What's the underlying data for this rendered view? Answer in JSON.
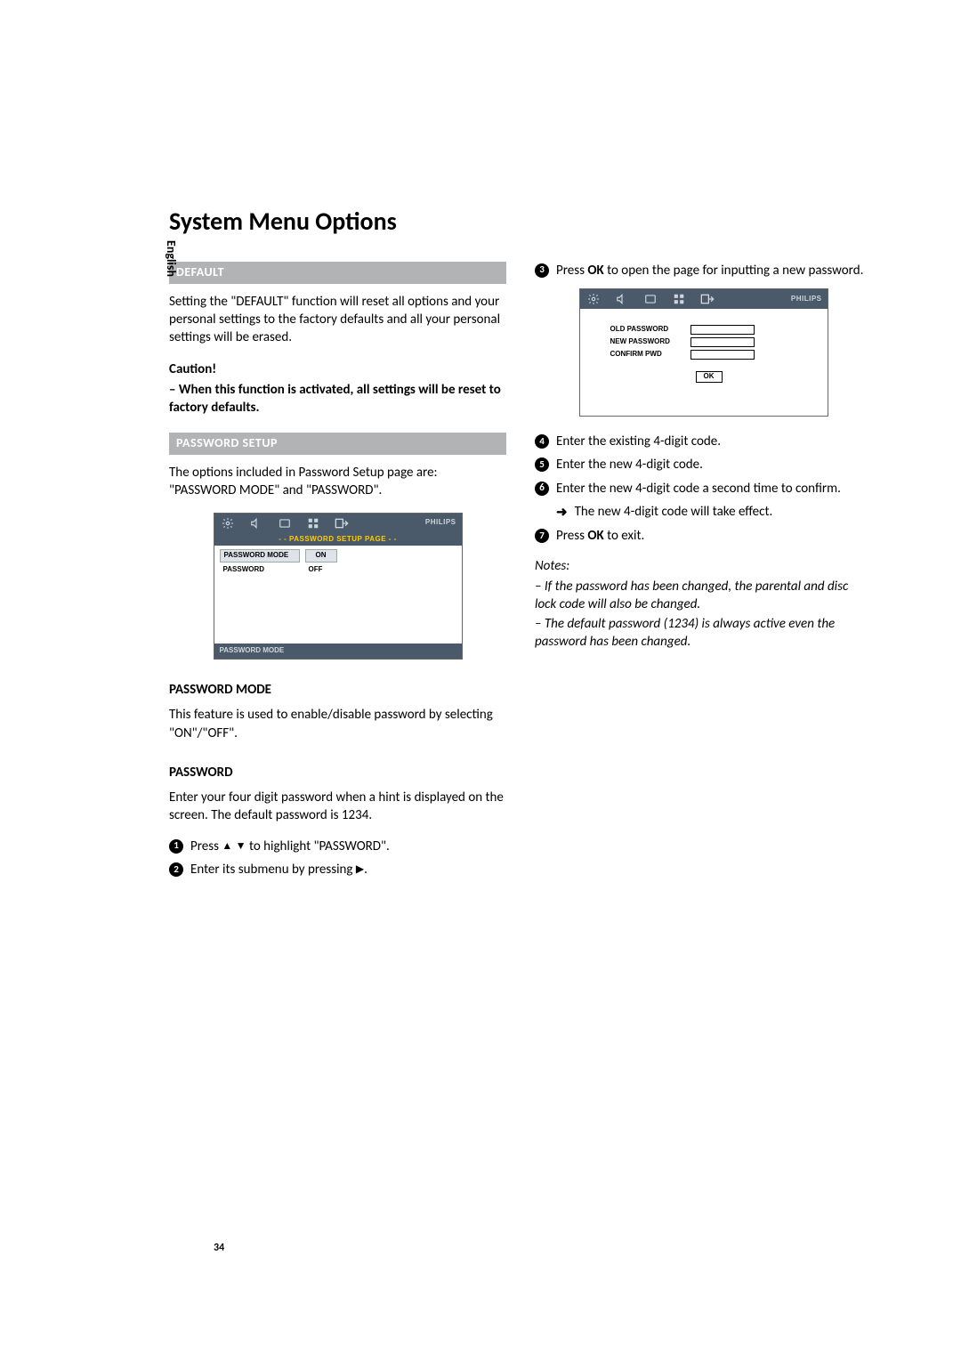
{
  "language_tab": "English",
  "title": "System Menu Options",
  "page_number": "34",
  "left": {
    "default_bar": "DEFAULT",
    "default_text": "Setting the \"DEFAULT\" function will reset all options and your personal settings to the factory defaults and all your personal settings will be erased.",
    "caution_heading": "Caution!",
    "caution_body": "– When this function is activated, all settings will be reset to factory defaults.",
    "pwsetup_bar": "PASSWORD SETUP",
    "pwsetup_text": "The options included in Password Setup page are: \"PASSWORD MODE\" and \"PASSWORD\".",
    "osd1": {
      "brand": "PHILIPS",
      "subbar": "- - PASSWORD SETUP PAGE - -",
      "row1_key": "PASSWORD MODE",
      "row1_val": "ON",
      "row2_key": "PASSWORD",
      "row2_val": "OFF",
      "footer": "PASSWORD MODE"
    },
    "pwmode_heading": "PASSWORD MODE",
    "pwmode_text": "This feature is used to enable/disable password by selecting \"ON\"/\"OFF\".",
    "pw_heading": "PASSWORD",
    "pw_text": "Enter your four digit password when a hint is displayed on the screen. The default password is 1234.",
    "step1_pre": "Press ",
    "step1_post": " to highlight \"PASSWORD\".",
    "step2_pre": "Enter its submenu by pressing ",
    "step2_post": "."
  },
  "right": {
    "step3_pre": "Press ",
    "step3_bold": "OK",
    "step3_post": " to open the page for inputting a new password.",
    "osd2": {
      "brand": "PHILIPS",
      "row1": "OLD PASSWORD",
      "row2": "NEW PASSWORD",
      "row3": "CONFIRM PWD",
      "ok": "OK"
    },
    "step4": "Enter the existing 4-digit code.",
    "step5": "Enter the new 4-digit code.",
    "step6": "Enter the new 4-digit code a second time to confirm.",
    "step6_sub": "The new 4-digit code will take effect.",
    "step7_pre": "Press ",
    "step7_bold": "OK",
    "step7_post": " to exit.",
    "notes_heading": "Notes:",
    "note1": "– If the password has been changed, the parental and disc lock code will also be changed.",
    "note2": "– The default password (1234) is always active even the password has been changed."
  }
}
